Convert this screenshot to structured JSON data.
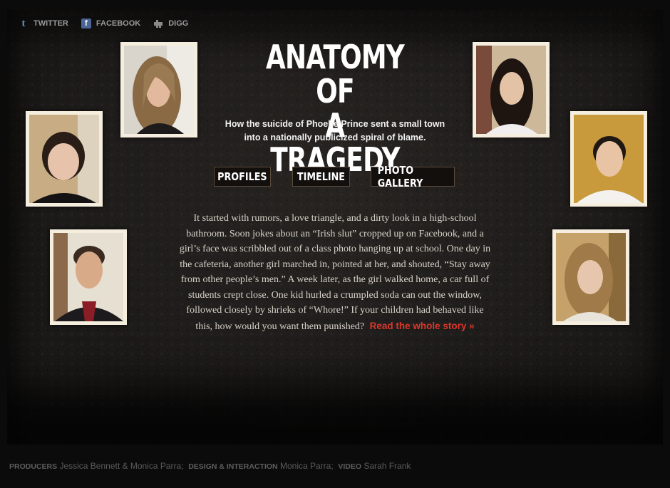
{
  "social": {
    "twitter": {
      "label": "TWITTER",
      "icon": "twitter-icon"
    },
    "facebook": {
      "label": "FACEBOOK",
      "icon": "facebook-icon"
    },
    "digg": {
      "label": "DIGG",
      "icon": "digg-icon"
    }
  },
  "header": {
    "title_line1": "ANATOMY OF",
    "title_line2": "A TRAGEDY",
    "subtitle_line1": "How the suicide of Phoebe Prince sent a small town",
    "subtitle_line2": "into a nationally publicized spiral of blame."
  },
  "nav": {
    "profiles": "PROFILES",
    "timeline": "TIMELINE",
    "gallery": "PHOTO GALLERY"
  },
  "story": {
    "text": "It started with rumors, a love triangle, and a dirty look in a high-school bathroom. Soon jokes about an “Irish slut” cropped up on Facebook, and a girl’s face was scribbled out of a class photo hanging up at school. One day in the cafeteria, another girl marched in, pointed at her, and shouted, “Stay away from other people’s men.” A week later, as the girl walked home, a car full of students crept close. One kid hurled a crumpled soda can out the window, followed closely by shrieks of “Whore!” If your children had behaved like this, how would you want them punished?",
    "read_more": "Read the whole story »"
  },
  "credits": {
    "producers_label": "PRODUCERS",
    "producers": "Jessica Bennett & Monica Parra;",
    "design_label": "DESIGN & INTERACTION",
    "design": "Monica Parra;",
    "video_label": "VIDEO",
    "video": "Sarah Frank"
  },
  "colors": {
    "accent_red": "#d8372b",
    "frame": "#f5eede",
    "button_border": "#5a4a3c",
    "facebook_blue": "#4b6596"
  }
}
